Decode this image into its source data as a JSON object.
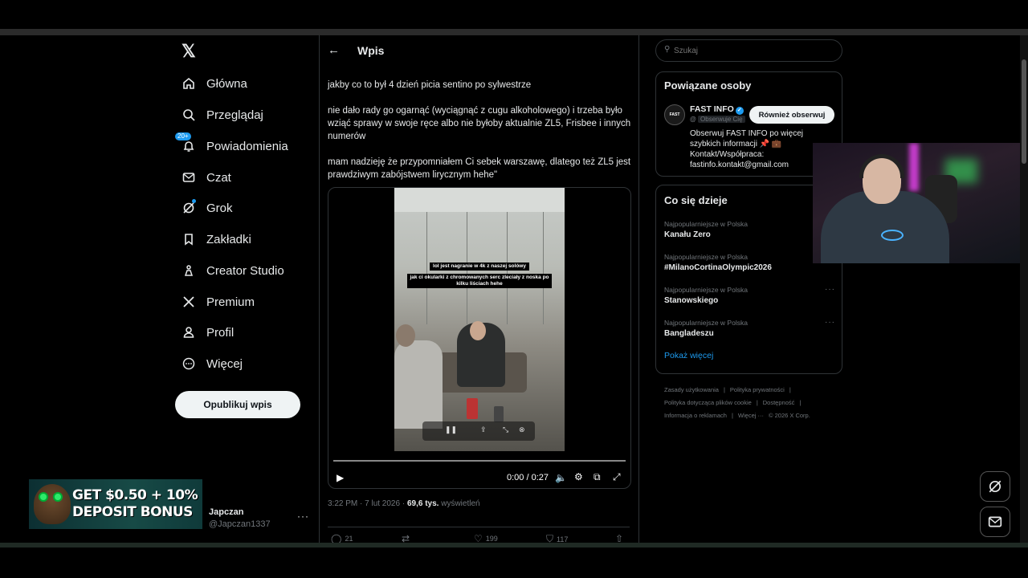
{
  "nav": {
    "logo": "𝕏",
    "items": [
      {
        "label": "Główna",
        "icon": "home-icon"
      },
      {
        "label": "Przeglądaj",
        "icon": "search-icon"
      },
      {
        "label": "Powiadomienia",
        "icon": "bell-icon",
        "badge": "20+"
      },
      {
        "label": "Czat",
        "icon": "mail-icon"
      },
      {
        "label": "Grok",
        "icon": "grok-icon"
      },
      {
        "label": "Zakładki",
        "icon": "bookmark-icon"
      },
      {
        "label": "Creator Studio",
        "icon": "creator-icon"
      },
      {
        "label": "Premium",
        "icon": "x-icon"
      },
      {
        "label": "Profil",
        "icon": "person-icon"
      },
      {
        "label": "Więcej",
        "icon": "more-circle-icon"
      }
    ],
    "post_button": "Opublikuj wpis",
    "profile_name": "Japczan",
    "profile_handle": "@Japczan1337",
    "profile_more": "···"
  },
  "promo": {
    "line1": "GET $0.50 + 10%",
    "line2": "DEPOSIT BONUS"
  },
  "post": {
    "header_title": "Wpis",
    "paragraphs": [
      "jakby co to był 4 dzień picia sentino po sylwestrze",
      "nie dało rady go ogarnąć (wyciągnąć z cugu alkoholowego) i trzeba było wziąć sprawy w swoje ręce albo nie byłoby aktualnie ZL5, Frisbee i innych numerów",
      "mam nadzieję że przypomniałem Ci sebek warszawę, dlatego też ZL5 jest prawdziwym zabójstwem lirycznym hehe\""
    ],
    "video": {
      "caption1": "lol jest nagranie w 4k z naszej solówy",
      "caption2": "jak ci okularki z chromowanych serc zleciały z noska po kilku liściach hehe",
      "time": "0:00 / 0:27"
    },
    "meta_time": "3:22 PM · 7 lut 2026 ·",
    "meta_views": "69,6 tys.",
    "meta_views_label": "wyświetleń",
    "replies": "21",
    "likes": "199",
    "bookmarks": "117"
  },
  "right": {
    "search_placeholder": "Szukaj",
    "related_title": "Powiązane osoby",
    "related_person": {
      "avatar": "FAST",
      "name": "FAST INFO",
      "handle_prefix": "@",
      "handle_tag": "Obserwuje Cię",
      "follow_label": "Również obserwuj",
      "bio": "Obserwuj FAST INFO po więcej szybkich informacji 📌 💼 Kontakt/Współpraca: fastinfo.kontakt@gmail.com"
    },
    "trends_title": "Co się dzieje",
    "trends": [
      {
        "category": "Najpopularniejsze w Polska",
        "name": "Kanału Zero"
      },
      {
        "category": "Najpopularniejsze w Polska",
        "name": "#MilanoCortinaOlympic2026"
      },
      {
        "category": "Najpopularniejsze w Polska",
        "name": "Stanowskiego"
      },
      {
        "category": "Najpopularniejsze w Polska",
        "name": "Bangladeszu"
      }
    ],
    "show_more": "Pokaż więcej",
    "footer": [
      [
        "Zasady użytkowania",
        "|",
        "Polityka prywatności",
        "|"
      ],
      [
        "Polityka dotycząca plików cookie",
        "|",
        "Dostępność",
        "|"
      ],
      [
        "Informacja o reklamach",
        "|",
        "Więcej ···",
        "© 2026 X Corp."
      ]
    ]
  },
  "colors": {
    "accent": "#1d9bf0",
    "background": "#000000",
    "border": "#2f3336",
    "muted": "#71767b"
  }
}
